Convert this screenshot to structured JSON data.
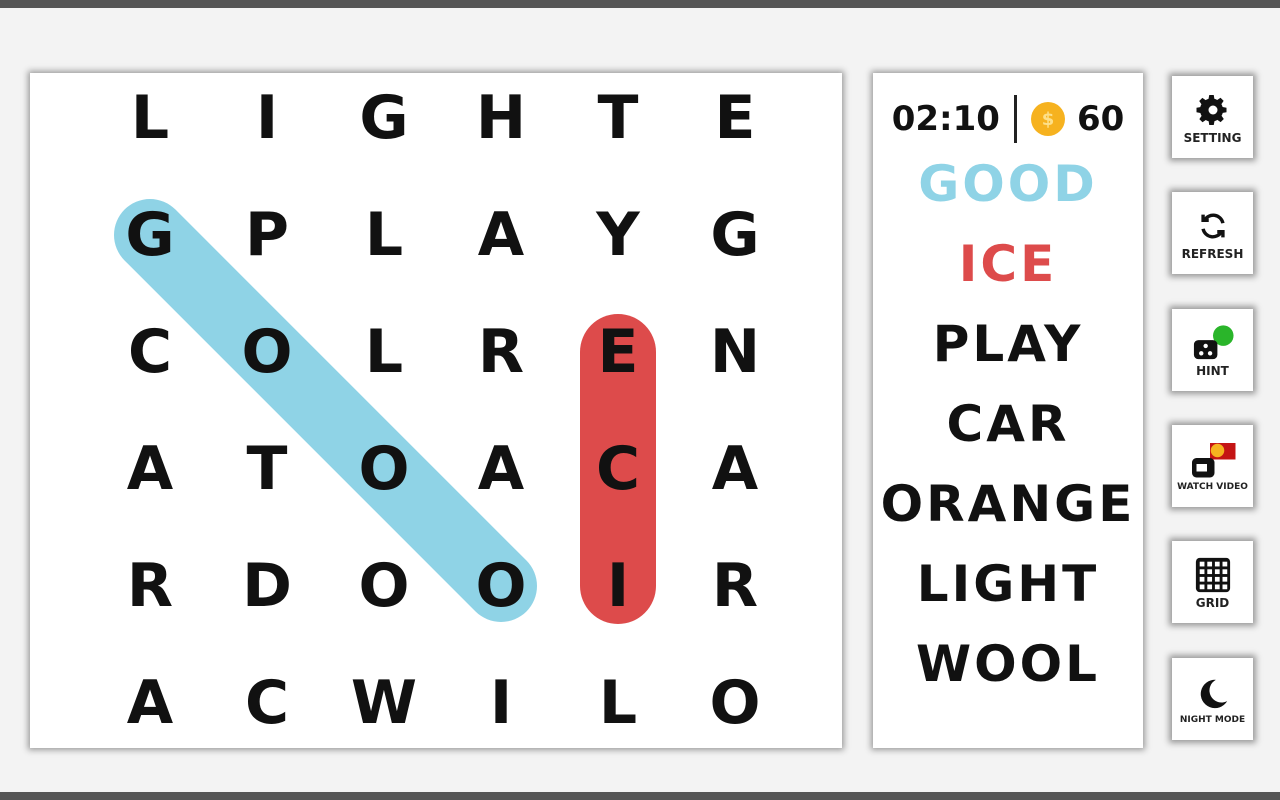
{
  "grid": [
    [
      "L",
      "I",
      "G",
      "H",
      "T",
      "E"
    ],
    [
      "G",
      "P",
      "L",
      "A",
      "Y",
      "G"
    ],
    [
      "C",
      "O",
      "L",
      "R",
      "E",
      "N"
    ],
    [
      "A",
      "T",
      "O",
      "A",
      "C",
      "A"
    ],
    [
      "R",
      "D",
      "O",
      "O",
      "I",
      "R"
    ],
    [
      "A",
      "C",
      "W",
      "I",
      "L",
      "O"
    ]
  ],
  "found": [
    {
      "word": "GOOD",
      "color": "#8fd3e6",
      "from": [
        1,
        0
      ],
      "to": [
        4,
        3
      ]
    },
    {
      "word": "ICE",
      "color": "#dd4b4b",
      "from": [
        4,
        4
      ],
      "to": [
        2,
        4
      ]
    }
  ],
  "status": {
    "timer": "02:10",
    "coins": "60",
    "coin_symbol": "$"
  },
  "words": [
    {
      "text": "GOOD",
      "state": "found",
      "color": "#8fd3e6"
    },
    {
      "text": "ICE",
      "state": "found",
      "color": "#dd4b4b"
    },
    {
      "text": "PLAY",
      "state": "pending",
      "color": "#111111"
    },
    {
      "text": "CAR",
      "state": "pending",
      "color": "#111111"
    },
    {
      "text": "ORANGE",
      "state": "pending",
      "color": "#111111"
    },
    {
      "text": "LIGHT",
      "state": "pending",
      "color": "#111111"
    },
    {
      "text": "WOOL",
      "state": "pending",
      "color": "#111111"
    }
  ],
  "buttons": [
    {
      "id": "setting",
      "label": "SETTING",
      "icon": "gear-icon"
    },
    {
      "id": "refresh",
      "label": "REFRESH",
      "icon": "refresh-icon"
    },
    {
      "id": "hint",
      "label": "HINT",
      "icon": "hint-icon"
    },
    {
      "id": "watch-video",
      "label": "WATCH VIDEO",
      "icon": "video-camera-icon"
    },
    {
      "id": "grid",
      "label": "GRID",
      "icon": "grid-icon"
    },
    {
      "id": "night-mode",
      "label": "NIGHT MODE",
      "icon": "moon-icon"
    }
  ]
}
